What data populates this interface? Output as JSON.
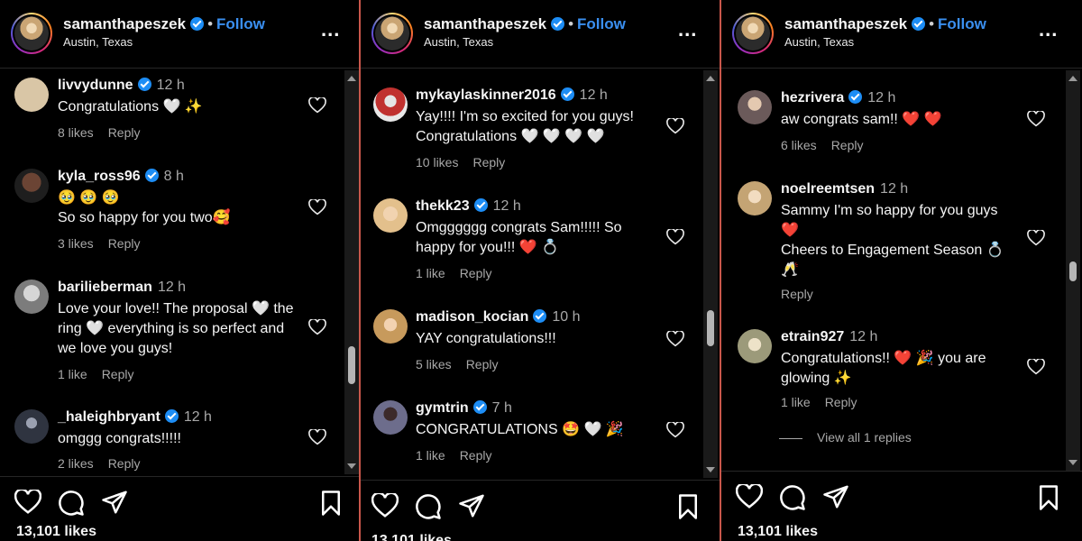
{
  "post": {
    "username": "samanthapeszek",
    "follow_label": "Follow",
    "location": "Austin, Texas",
    "more_label": "...",
    "likes_text": "13,101 likes"
  },
  "panels": [
    {
      "comments": [
        {
          "user": "livvydunne",
          "verified": true,
          "time": "12 h",
          "text": "Congratulations 🤍 ✨",
          "likes": "8 likes",
          "reply": "Reply",
          "avatar": "#d9c6a6"
        },
        {
          "user": "kyla_ross96",
          "verified": true,
          "time": "8 h",
          "text": "🥹 🥹 🥹\nSo so happy for you two🥰",
          "likes": "3 likes",
          "reply": "Reply",
          "avatar": "#5a3a2a"
        },
        {
          "user": "barilieberman",
          "verified": false,
          "time": "12 h",
          "text": "Love your love!! The proposal 🤍 the ring 🤍 everything is so perfect and we love you guys!",
          "likes": "1 like",
          "reply": "Reply",
          "avatar": "#8e8e8e"
        },
        {
          "user": "_haleighbryant",
          "verified": true,
          "time": "12 h",
          "text": "omggg congrats!!!!!",
          "likes": "2 likes",
          "reply": "Reply",
          "avatar": "#2f3440"
        }
      ]
    },
    {
      "comments": [
        {
          "user": "mykaylaskinner2016",
          "verified": true,
          "time": "12 h",
          "text": "Yay!!!! I'm so excited for you guys! Congratulations 🤍 🤍 🤍 🤍",
          "likes": "10 likes",
          "reply": "Reply",
          "avatar": "#d8d8d8"
        },
        {
          "user": "thekk23",
          "verified": true,
          "time": "12 h",
          "text": "Omgggggg congrats Sam!!!!! So happy for you!!! ❤️ 💍",
          "likes": "1 like",
          "reply": "Reply",
          "avatar": "#e2c3a0"
        },
        {
          "user": "madison_kocian",
          "verified": true,
          "time": "10 h",
          "text": "YAY congratulations!!!",
          "likes": "5 likes",
          "reply": "Reply",
          "avatar": "#caa26a"
        },
        {
          "user": "gymtrin",
          "verified": true,
          "time": "7 h",
          "text": "CONGRATULATIONS 🤩 🤍 🎉",
          "likes": "1 like",
          "reply": "Reply",
          "avatar": "#6d6d8c"
        }
      ]
    },
    {
      "comments": [
        {
          "user": "hezrivera",
          "verified": true,
          "time": "12 h",
          "text": "aw congrats sam!! ❤️ ❤️",
          "likes": "6 likes",
          "reply": "Reply",
          "avatar": "#7a6a66"
        },
        {
          "user": "noelreemtsen",
          "verified": false,
          "time": "12 h",
          "text": "Sammy I'm so happy for you guys ❤️\nCheers to Engagement Season 💍 🥂",
          "likes": "",
          "reply": "Reply",
          "avatar": "#d9c19a"
        },
        {
          "user": "etrain927",
          "verified": false,
          "time": "12 h",
          "text": "Congratulations!! ❤️ 🎉 you are glowing ✨",
          "likes": "1 like",
          "reply": "Reply",
          "avatar": "#b7b39a"
        }
      ],
      "view_all": "View all 1 replies"
    }
  ],
  "icons": {
    "heart": "heart-icon",
    "comment": "comment-icon",
    "share": "send-icon",
    "save": "bookmark-icon",
    "more": "more-icon"
  },
  "colors": {
    "background": "#000000",
    "follow": "#3a8ff0",
    "verified": "#1d8df5",
    "divider": "#c9574b",
    "muted": "#a8a8a8"
  }
}
